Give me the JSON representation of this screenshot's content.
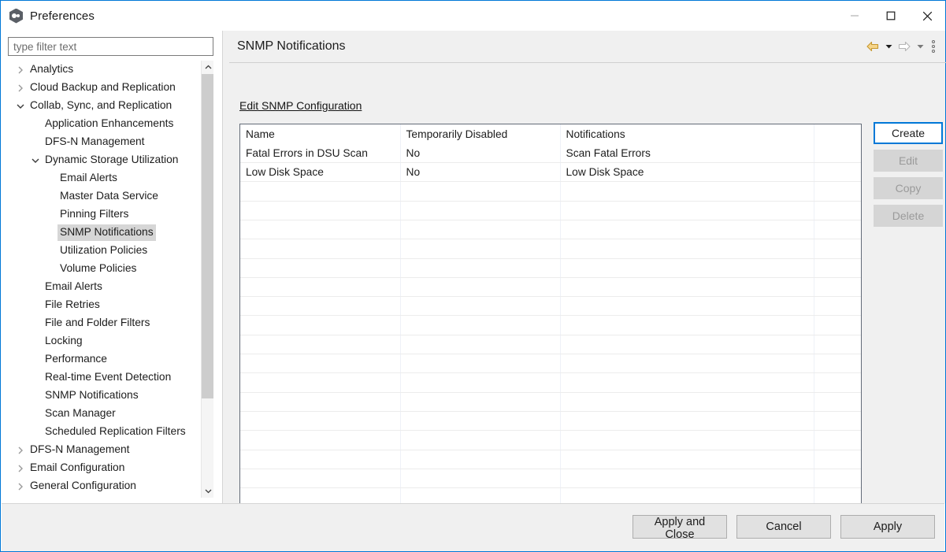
{
  "window": {
    "title": "Preferences",
    "app_icon": "hexagon-app-icon",
    "controls": {
      "minimize": "minimize-icon",
      "maximize": "maximize-icon",
      "close": "close-icon"
    }
  },
  "filter": {
    "placeholder": "type filter text",
    "value": ""
  },
  "tree": {
    "items": [
      {
        "label": "Analytics",
        "indent": 0,
        "twisty": "collapsed",
        "selected": false
      },
      {
        "label": "Cloud Backup and Replication",
        "indent": 0,
        "twisty": "collapsed",
        "selected": false
      },
      {
        "label": "Collab, Sync, and Replication",
        "indent": 0,
        "twisty": "expanded",
        "selected": false
      },
      {
        "label": "Application Enhancements",
        "indent": 1,
        "twisty": "none",
        "selected": false
      },
      {
        "label": "DFS-N Management",
        "indent": 1,
        "twisty": "none",
        "selected": false
      },
      {
        "label": "Dynamic Storage Utilization",
        "indent": 1,
        "twisty": "expanded",
        "selected": false
      },
      {
        "label": "Email Alerts",
        "indent": 2,
        "twisty": "none",
        "selected": false
      },
      {
        "label": "Master Data Service",
        "indent": 2,
        "twisty": "none",
        "selected": false
      },
      {
        "label": "Pinning Filters",
        "indent": 2,
        "twisty": "none",
        "selected": false
      },
      {
        "label": "SNMP Notifications",
        "indent": 2,
        "twisty": "none",
        "selected": true
      },
      {
        "label": "Utilization Policies",
        "indent": 2,
        "twisty": "none",
        "selected": false
      },
      {
        "label": "Volume Policies",
        "indent": 2,
        "twisty": "none",
        "selected": false
      },
      {
        "label": "Email Alerts",
        "indent": 1,
        "twisty": "none",
        "selected": false
      },
      {
        "label": "File Retries",
        "indent": 1,
        "twisty": "none",
        "selected": false
      },
      {
        "label": "File and Folder Filters",
        "indent": 1,
        "twisty": "none",
        "selected": false
      },
      {
        "label": "Locking",
        "indent": 1,
        "twisty": "none",
        "selected": false
      },
      {
        "label": "Performance",
        "indent": 1,
        "twisty": "none",
        "selected": false
      },
      {
        "label": "Real-time Event Detection",
        "indent": 1,
        "twisty": "none",
        "selected": false
      },
      {
        "label": "SNMP Notifications",
        "indent": 1,
        "twisty": "none",
        "selected": false
      },
      {
        "label": "Scan Manager",
        "indent": 1,
        "twisty": "none",
        "selected": false
      },
      {
        "label": "Scheduled Replication Filters",
        "indent": 1,
        "twisty": "none",
        "selected": false
      },
      {
        "label": "DFS-N Management",
        "indent": 0,
        "twisty": "collapsed",
        "selected": false
      },
      {
        "label": "Email Configuration",
        "indent": 0,
        "twisty": "collapsed",
        "selected": false
      },
      {
        "label": "General Configuration",
        "indent": 0,
        "twisty": "collapsed",
        "selected": false
      }
    ],
    "scrollbar": {
      "up_arrow": "chevron-up-icon",
      "down_arrow": "chevron-down-icon"
    }
  },
  "panel": {
    "title": "SNMP Notifications",
    "nav": {
      "back_icon": "back-arrow-icon",
      "back_caret": "chevron-down-icon",
      "forward_icon": "forward-arrow-icon",
      "forward_caret": "chevron-down-icon",
      "menu_icon": "view-menu-icon",
      "back_color": "#e8a33d",
      "forward_color": "#bfbfbf"
    },
    "edit_link": "Edit SNMP Configuration",
    "table": {
      "columns": [
        "Name",
        "Temporarily Disabled",
        "Notifications",
        ""
      ],
      "rows": [
        [
          "Fatal Errors in DSU Scan",
          "No",
          "Scan Fatal Errors",
          ""
        ],
        [
          "Low Disk Space",
          "No",
          "Low Disk Space",
          ""
        ]
      ],
      "empty_row_count": 18
    },
    "actions": [
      {
        "label": "Create",
        "state": "enabled-focused"
      },
      {
        "label": "Edit",
        "state": "disabled"
      },
      {
        "label": "Copy",
        "state": "disabled"
      },
      {
        "label": "Delete",
        "state": "disabled"
      }
    ]
  },
  "footer": {
    "buttons": [
      {
        "label": "Apply and Close"
      },
      {
        "label": "Cancel"
      },
      {
        "label": "Apply"
      }
    ]
  },
  "colors": {
    "accent": "#0078d7",
    "panel_bg": "#f0f0f0",
    "selection": "#d6d6d6"
  }
}
